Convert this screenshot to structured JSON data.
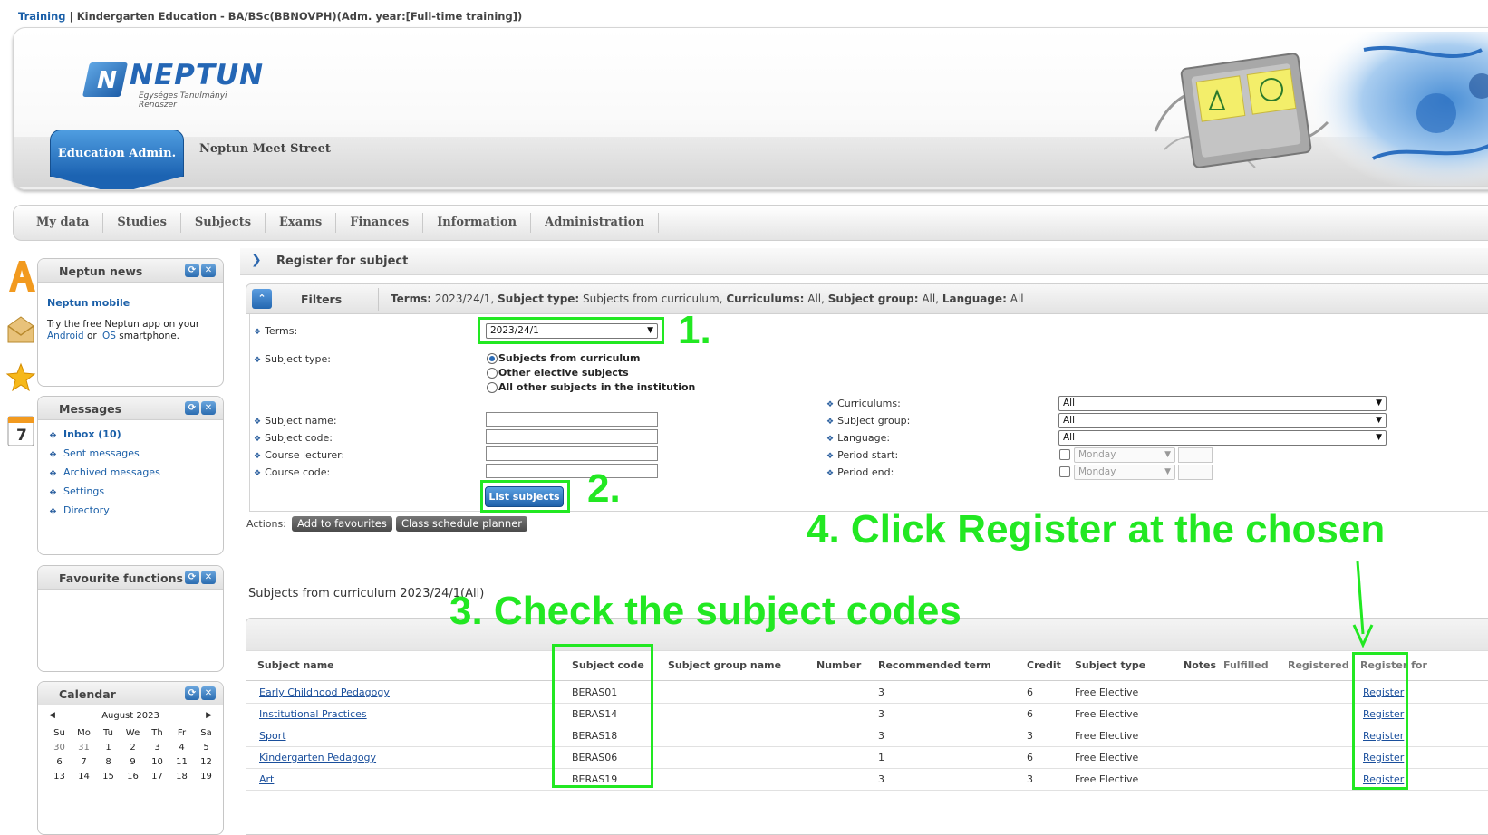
{
  "breadcrumb": {
    "link": "Training",
    "separator": " | ",
    "program": "Kindergarten Education - BA/BSc(BBNOVPH)(Adm. year:[Full-time training])"
  },
  "header": {
    "logo_mark": "N",
    "logo_text": "NEPTUN",
    "logo_subtitle": "Egységes Tanulmányi Rendszer",
    "module_tab": "Education Admin.",
    "module_link": "Neptun Meet Street"
  },
  "menu": [
    "My data",
    "Studies",
    "Subjects",
    "Exams",
    "Finances",
    "Information",
    "Administration"
  ],
  "side_icons": [
    "a-icon",
    "envelope-icon",
    "star-icon",
    "calendar-icon"
  ],
  "calendar_icon_day": "7",
  "news": {
    "title": "Neptun news",
    "heading": "Neptun mobile",
    "text_1": "Try the free Neptun app on your",
    "android": "Android",
    "or": " or ",
    "ios": "iOS",
    "text_2": " smartphone."
  },
  "messages": {
    "title": "Messages",
    "items": [
      "Inbox (10)",
      "Sent messages",
      "Archived messages",
      "Settings",
      "Directory"
    ]
  },
  "favourites": {
    "title": "Favourite functions"
  },
  "calendar": {
    "title": "Calendar",
    "month": "August 2023",
    "weekdays": [
      "Su",
      "Mo",
      "Tu",
      "We",
      "Th",
      "Fr",
      "Sa"
    ],
    "week1": [
      "30",
      "31",
      "1",
      "2",
      "3",
      "4",
      "5"
    ],
    "week2": [
      "6",
      "7",
      "8",
      "9",
      "10",
      "11",
      "12"
    ],
    "week3": [
      "13",
      "14",
      "15",
      "16",
      "17",
      "18",
      "19"
    ]
  },
  "page": {
    "title": "Register for subject"
  },
  "filters": {
    "label": "Filters",
    "summary": {
      "terms_label": "Terms:",
      "terms_value": " 2023/24/1, ",
      "type_label": "Subject type:",
      "type_value": " Subjects from curriculum, ",
      "curr_label": "Curriculums:",
      "curr_value": " All, ",
      "group_label": "Subject group:",
      "group_value": " All, ",
      "lang_label": "Language:",
      "lang_value": " All"
    },
    "terms_label": "Terms:",
    "terms_value": "2023/24/1",
    "subject_type_label": "Subject type:",
    "subject_type_options": [
      "Subjects from curriculum",
      "Other elective subjects",
      "All other subjects in the institution"
    ],
    "subject_name_label": "Subject name:",
    "subject_code_label": "Subject code:",
    "course_lecturer_label": "Course lecturer:",
    "course_code_label": "Course code:",
    "curriculums_label": "Curriculums:",
    "curriculums_value": "All",
    "subject_group_label": "Subject group:",
    "subject_group_value": "All",
    "language_label": "Language:",
    "language_value": "All",
    "period_start_label": "Period start:",
    "period_end_label": "Period end:",
    "period_day": "Monday",
    "list_button": "List subjects"
  },
  "actions": {
    "label": "Actions:",
    "add_fav": "Add to favourites",
    "planner": "Class schedule planner"
  },
  "table": {
    "caption": "Subjects from curriculum 2023/24/1(All)",
    "headers": [
      "Subject name",
      "Subject code",
      "Subject group name",
      "Number",
      "Recommended term",
      "Credit",
      "Subject type",
      "Notes",
      "Fulfilled",
      "Registered",
      "Register for"
    ],
    "rows": [
      {
        "name": "Early Childhood Pedagogy",
        "code": "BERAS01",
        "term": "3",
        "credit": "6",
        "type": "Free Elective",
        "action": "Register"
      },
      {
        "name": "Institutional Practices",
        "code": "BERAS14",
        "term": "3",
        "credit": "6",
        "type": "Free Elective",
        "action": "Register"
      },
      {
        "name": "Sport",
        "code": "BERAS18",
        "term": "3",
        "credit": "3",
        "type": "Free Elective",
        "action": "Register"
      },
      {
        "name": "Kindergarten Pedagogy",
        "code": "BERAS06",
        "term": "1",
        "credit": "6",
        "type": "Free Elective",
        "action": "Register"
      },
      {
        "name": "Art",
        "code": "BERAS19",
        "term": "3",
        "credit": "3",
        "type": "Free Elective",
        "action": "Register"
      }
    ]
  },
  "annotations": {
    "step1": "1.",
    "step2": "2.",
    "step3": "3. Check the subject codes",
    "step4": "4. Click Register at the chosen",
    "color": "#22e822"
  }
}
